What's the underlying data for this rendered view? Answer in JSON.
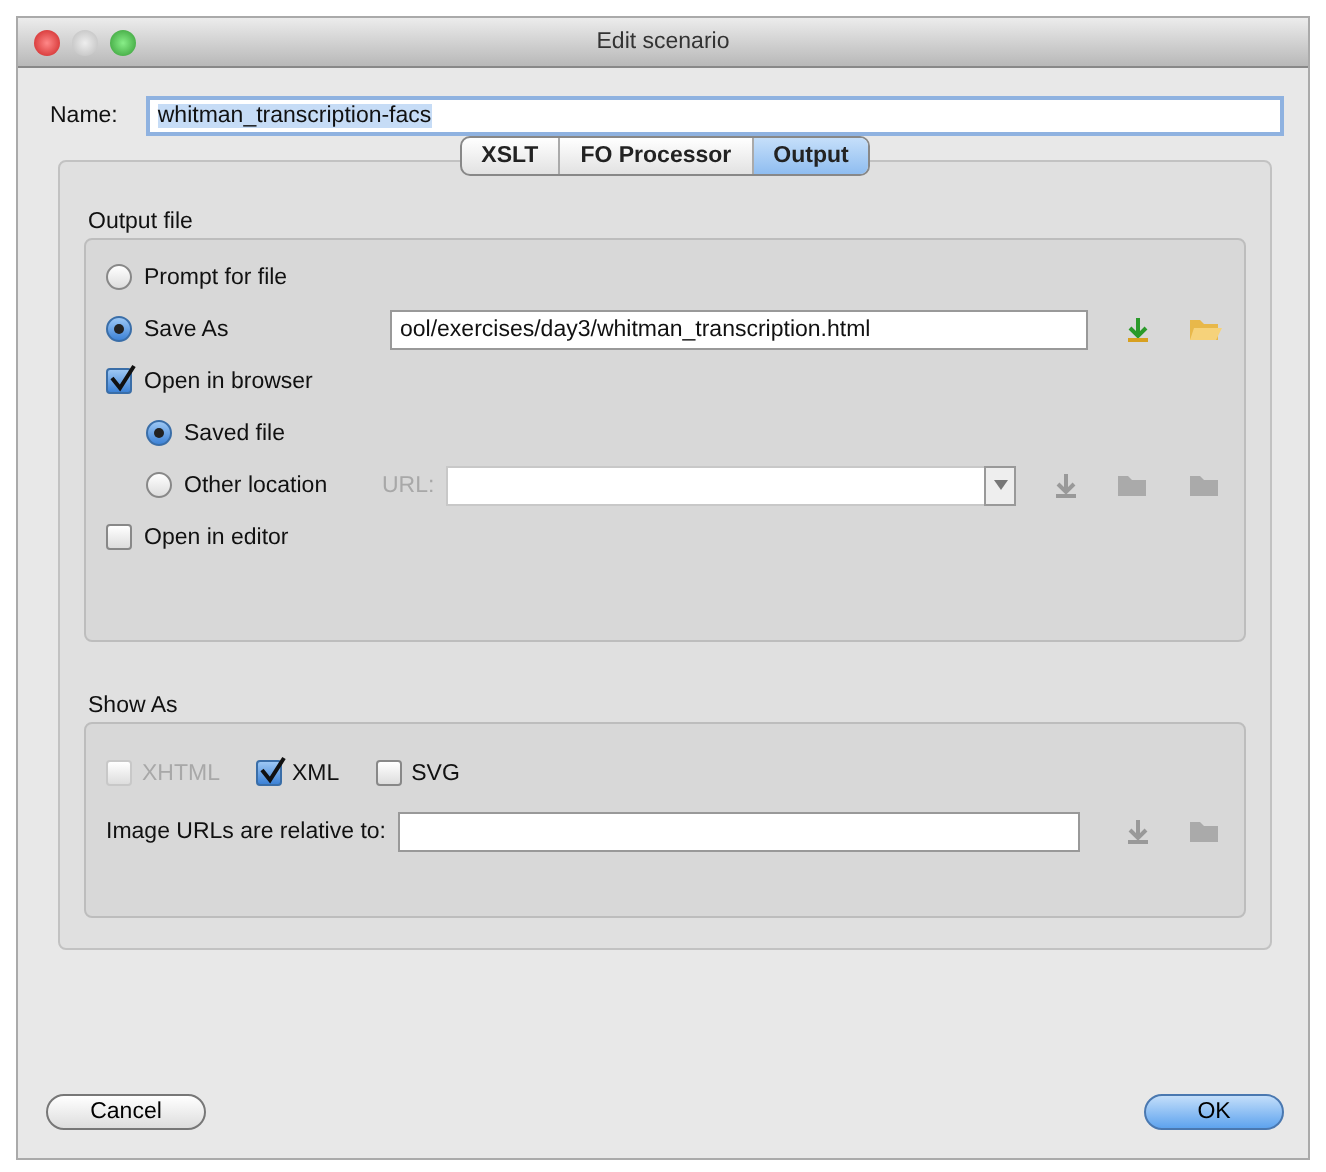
{
  "window": {
    "title": "Edit scenario"
  },
  "name": {
    "label": "Name:",
    "value": "whitman_transcription-facs"
  },
  "tabs": [
    {
      "label": "XSLT",
      "selected": false
    },
    {
      "label": "FO Processor",
      "selected": false
    },
    {
      "label": "Output",
      "selected": true
    }
  ],
  "output_file": {
    "title": "Output file",
    "options": [
      {
        "kind": "radio",
        "label": "Prompt for file",
        "selected": false
      },
      {
        "kind": "radio",
        "label": "Save As",
        "selected": true,
        "field": {
          "value": "ool/exercises/day3/whitman_transcription.html",
          "disabled": false
        }
      },
      {
        "kind": "checkbox",
        "label": "Open in browser",
        "checked": true,
        "children": [
          {
            "kind": "radio",
            "label": "Saved file",
            "selected": true
          },
          {
            "kind": "radio",
            "label": "Other location",
            "selected": false,
            "url_label": "URL:",
            "field": {
              "disabled": true,
              "combo": true
            }
          }
        ]
      },
      {
        "kind": "checkbox",
        "label": "Open in editor",
        "checked": false
      }
    ]
  },
  "show_as": {
    "title": "Show As",
    "formats": [
      {
        "label": "XHTML",
        "checked": false,
        "disabled": true
      },
      {
        "label": "XML",
        "checked": true,
        "disabled": false
      },
      {
        "label": "SVG",
        "checked": false,
        "disabled": false
      }
    ],
    "relative": {
      "label": "Image URLs are relative to:"
    }
  },
  "buttons": [
    {
      "label": "Cancel",
      "default": false
    },
    {
      "label": "OK",
      "default": true
    }
  ]
}
